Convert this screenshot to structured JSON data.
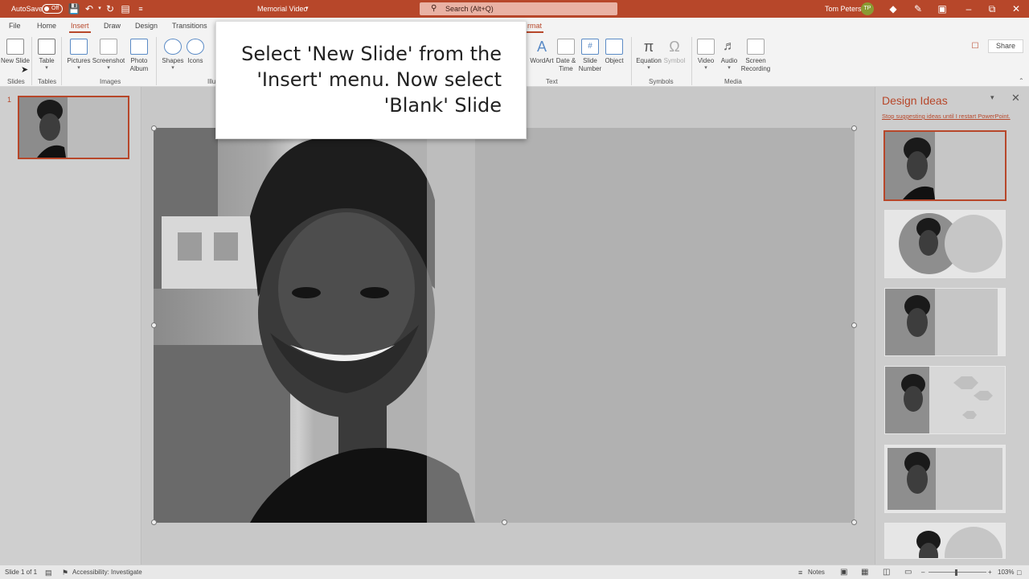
{
  "titlebar": {
    "autosave_label": "AutoSave",
    "autosave_state": "Off",
    "document_title": "Memorial Video",
    "search_placeholder": "Search (Alt+Q)",
    "user_name": "Tom Peters",
    "user_initials": "TP",
    "accent_color": "#b7472a"
  },
  "ribbon": {
    "tabs": [
      "File",
      "Home",
      "Insert",
      "Draw",
      "Design",
      "Transitions"
    ],
    "hidden_tab_fragment": "rmat",
    "active_tab": "Insert",
    "share_label": "Share",
    "buttons": {
      "new_slide": "New Slide",
      "table": "Table",
      "pictures": "Pictures",
      "screenshot": "Screenshot",
      "photo_album": "Photo Album",
      "shapes": "Shapes",
      "icons": "Icons",
      "wordart": "WordArt",
      "date_time": "Date & Time",
      "slide_number": "Slide Number",
      "object": "Object",
      "equation": "Equation",
      "symbol": "Symbol",
      "video": "Video",
      "audio": "Audio",
      "screen_recording": "Screen Recording"
    },
    "groups": {
      "slides": "Slides",
      "tables": "Tables",
      "images": "Images",
      "illustrations_fragment": "Illu",
      "text": "Text",
      "symbols": "Symbols",
      "media": "Media"
    }
  },
  "thumbnails": {
    "slide_number": "1"
  },
  "callout": {
    "text": "Select 'New Slide' from the 'Insert' menu. Now select 'Blank' Slide"
  },
  "design_ideas": {
    "title": "Design Ideas",
    "stop_link": "Stop suggesting ideas until I restart PowerPoint."
  },
  "statusbar": {
    "slide_count": "Slide 1 of 1",
    "accessibility": "Accessibility: Investigate",
    "notes": "Notes",
    "zoom": "103%"
  }
}
